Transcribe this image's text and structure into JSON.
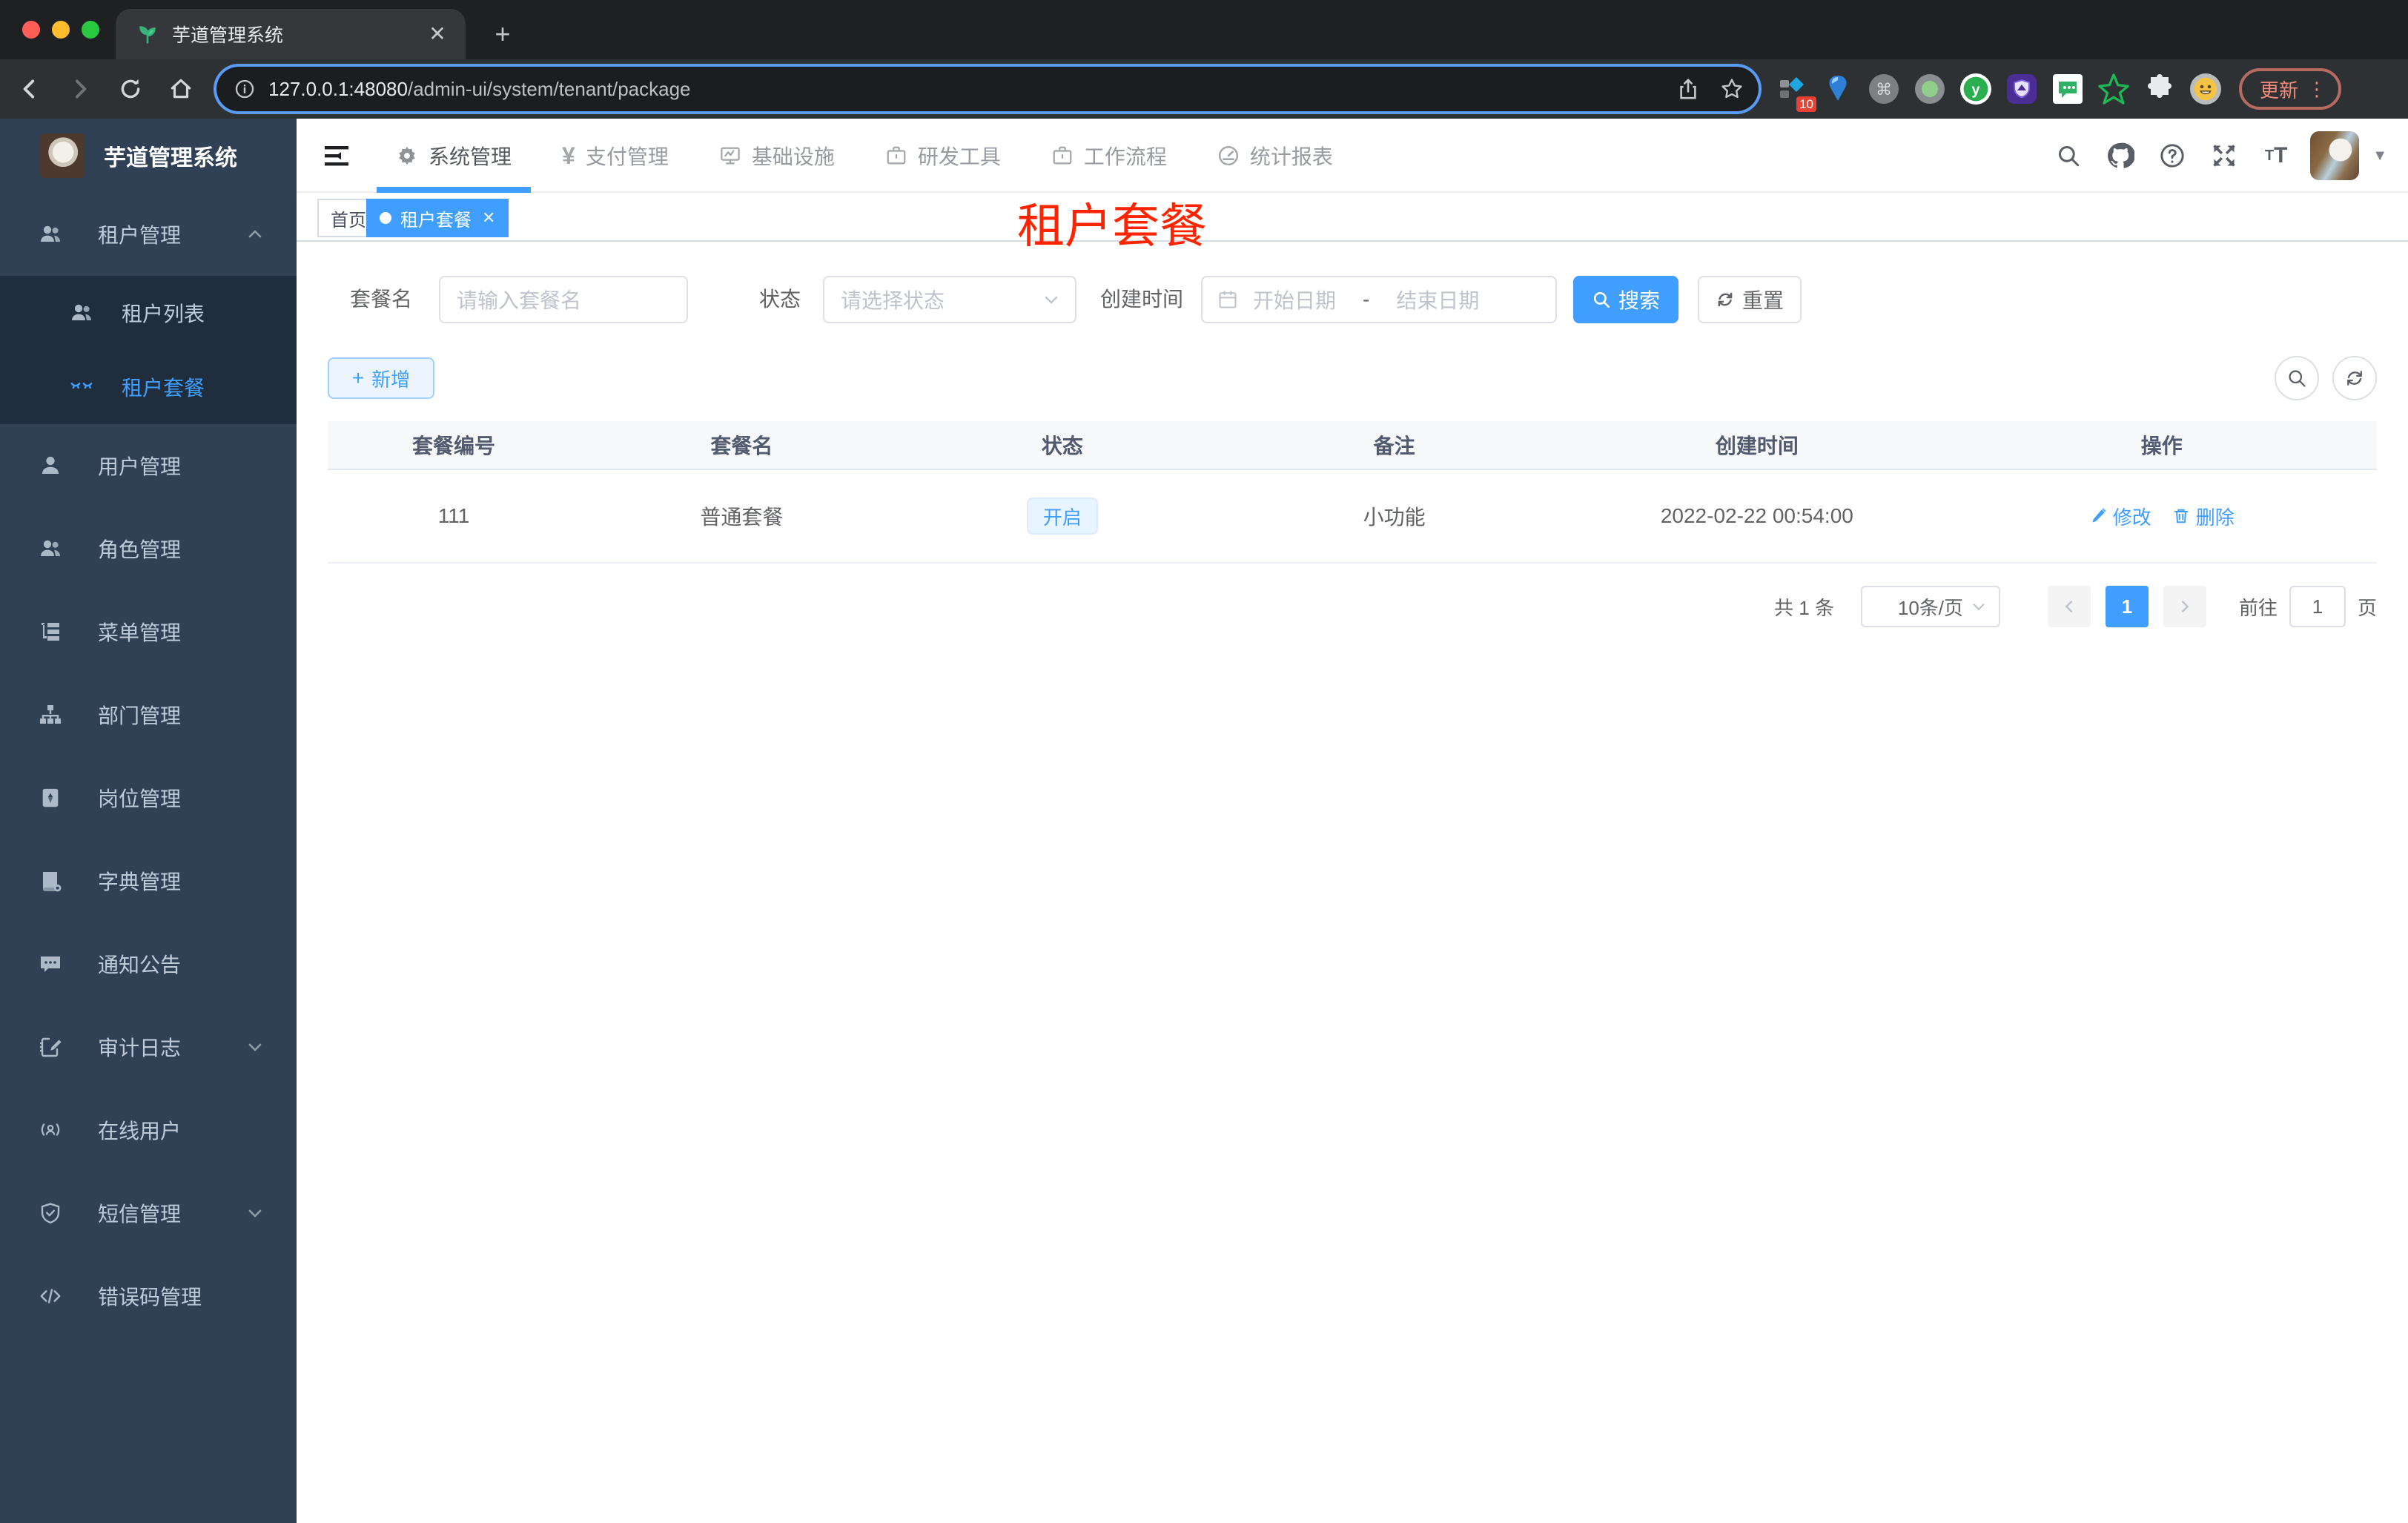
{
  "colors": {
    "accent": "#409eff",
    "sidebar_bg": "#304156",
    "submenu_bg": "#1f2d3d",
    "tag_active": "#409eff",
    "overlay_red": "#ff2400"
  },
  "browser": {
    "tab_title": "芋道管理系统",
    "url_host": "127.0.0.1:48080",
    "url_path": "/admin-ui/system/tenant/package",
    "extension_badge": "10",
    "update_label": "更新",
    "kebab": "⋮"
  },
  "sidebar": {
    "title": "芋道管理系统",
    "items": [
      {
        "label": "租户管理"
      },
      {
        "label": "租户列表"
      },
      {
        "label": "租户套餐"
      },
      {
        "label": "用户管理"
      },
      {
        "label": "角色管理"
      },
      {
        "label": "菜单管理"
      },
      {
        "label": "部门管理"
      },
      {
        "label": "岗位管理"
      },
      {
        "label": "字典管理"
      },
      {
        "label": "通知公告"
      },
      {
        "label": "审计日志"
      },
      {
        "label": "在线用户"
      },
      {
        "label": "短信管理"
      },
      {
        "label": "错误码管理"
      }
    ]
  },
  "topnav": {
    "items": [
      {
        "label": "系统管理"
      },
      {
        "label": "支付管理"
      },
      {
        "label": "基础设施"
      },
      {
        "label": "研发工具"
      },
      {
        "label": "工作流程"
      },
      {
        "label": "统计报表"
      }
    ]
  },
  "tags": {
    "home": "首页",
    "active": "租户套餐"
  },
  "overlay_title": "租户套餐",
  "filter": {
    "name_label": "套餐名",
    "name_placeholder": "请输入套餐名",
    "status_label": "状态",
    "status_placeholder": "请选择状态",
    "date_label": "创建时间",
    "date_start": "开始日期",
    "date_sep": "-",
    "date_end": "结束日期",
    "search": "搜索",
    "reset": "重置"
  },
  "toolbar": {
    "add": "新增"
  },
  "table": {
    "columns": [
      "套餐编号",
      "套餐名",
      "状态",
      "备注",
      "创建时间",
      "操作"
    ],
    "rows": [
      {
        "id": "111",
        "name": "普通套餐",
        "status": "开启",
        "remark": "小功能",
        "created": "2022-02-22 00:54:00",
        "edit": "修改",
        "delete": "删除"
      }
    ]
  },
  "pagination": {
    "total": "共 1 条",
    "page_size": "10条/页",
    "page": "1",
    "goto": "前往",
    "goto_value": "1",
    "unit": "页"
  }
}
